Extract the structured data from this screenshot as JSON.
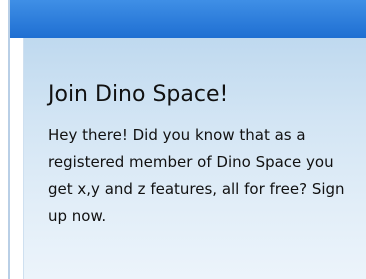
{
  "panel": {
    "title": "Join Dino Space!",
    "message": "Hey there! Did you know that as a registered member of Dino Space you get x,y and z features, all for free? Sign up now."
  },
  "colors": {
    "top_bar": "#2a7ddc",
    "panel_top": "#bfd9ef",
    "panel_bottom": "#ecf4fb",
    "text": "#111111"
  }
}
